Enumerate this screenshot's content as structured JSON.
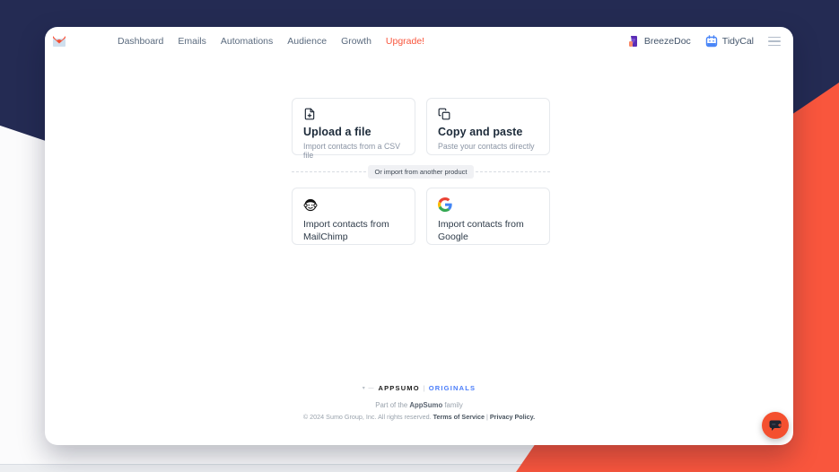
{
  "colors": {
    "navy_bg": "#242b53",
    "orange_accent": "#f9563d",
    "originals_blue": "#4a7dfa",
    "tidycal_blue": "#4a86f7",
    "breezedoc_purple": "#5b2db5"
  },
  "nav": {
    "brand_icon": "sendfox-fox-envelope-logo",
    "items": [
      {
        "label": "Dashboard"
      },
      {
        "label": "Emails"
      },
      {
        "label": "Automations"
      },
      {
        "label": "Audience"
      },
      {
        "label": "Growth"
      }
    ],
    "upgrade_label": "Upgrade!",
    "apps": [
      {
        "label": "BreezeDoc",
        "icon": "breezedoc-icon"
      },
      {
        "label": "TidyCal",
        "icon": "tidycal-calendar-icon"
      }
    ],
    "menu_icon": "hamburger-menu-icon"
  },
  "import_options": [
    {
      "icon": "file-plus-icon",
      "title": "Upload a file",
      "subtitle": "Import contacts from a CSV file"
    },
    {
      "icon": "copy-icon",
      "title": "Copy and paste",
      "subtitle": "Paste your contacts directly"
    }
  ],
  "divider_label": "Or import from another product",
  "provider_options": [
    {
      "icon": "mailchimp-icon",
      "label": "Import contacts from MailChimp"
    },
    {
      "icon": "google-icon",
      "label": "Import contacts from Google"
    }
  ],
  "footer": {
    "appsumo_wordmark": "APPSUMO",
    "separator": "|",
    "originals_wordmark": "ORIGINALS",
    "family_prefix": "Part of the ",
    "family_bold": "AppSumo",
    "family_suffix": " family",
    "copyright_prefix": "© 2024 Sumo Group, Inc. All rights reserved. ",
    "terms_label": "Terms of Service",
    "legal_separator": " | ",
    "privacy_label": "Privacy Policy."
  },
  "chat": {
    "icon": "chat-bubble-icon"
  }
}
